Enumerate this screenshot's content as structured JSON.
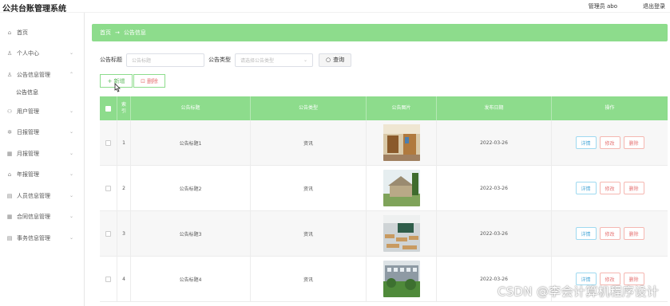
{
  "app": {
    "title": "公共台账管理系统",
    "user_label": "管理员 abo",
    "logout_label": "退出登录"
  },
  "sidebar": {
    "items": [
      {
        "label": "首页",
        "icon": "home-icon"
      },
      {
        "label": "个人中心",
        "icon": "user-icon"
      },
      {
        "label": "公告信息管理",
        "icon": "user-icon"
      },
      {
        "label": "公告信息",
        "icon": ""
      },
      {
        "label": "用户管理",
        "icon": "users-icon"
      },
      {
        "label": "日报管理",
        "icon": "gear-icon"
      },
      {
        "label": "月报管理",
        "icon": "grid-icon"
      },
      {
        "label": "年报管理",
        "icon": "bank-icon"
      },
      {
        "label": "人员信息管理",
        "icon": "list-icon"
      },
      {
        "label": "合同信息管理",
        "icon": "grid-icon"
      },
      {
        "label": "事务信息管理",
        "icon": "list-icon"
      }
    ]
  },
  "breadcrumb": {
    "home": "首页",
    "sep": "→",
    "current": "公告信息"
  },
  "search": {
    "title_label": "公告标题",
    "title_placeholder": "公告标题",
    "type_label": "公告类型",
    "type_placeholder": "请选择公告类型",
    "query_label": "查询"
  },
  "actions": {
    "add_label": "+ 新增",
    "delete_label": "删除"
  },
  "table": {
    "headers": {
      "index": "索引",
      "title": "公告标题",
      "type": "公告类型",
      "image": "公告图片",
      "date": "发布日期",
      "ops": "操作"
    },
    "rows": [
      {
        "index": "1",
        "title": "公告标题1",
        "type": "资讯",
        "date": "2022-03-26"
      },
      {
        "index": "2",
        "title": "公告标题2",
        "type": "资讯",
        "date": "2022-03-26"
      },
      {
        "index": "3",
        "title": "公告标题3",
        "type": "资讯",
        "date": "2022-03-26"
      },
      {
        "index": "4",
        "title": "公告标题4",
        "type": "资讯",
        "date": "2022-03-26"
      }
    ],
    "ops": {
      "detail": "详情",
      "edit": "修改",
      "remove": "删除"
    }
  },
  "watermark": "CSDN @李会计算机程序设计",
  "colors": {
    "accent": "#8ddc8c",
    "detail": "#4aa8d8",
    "danger": "#e57373"
  }
}
